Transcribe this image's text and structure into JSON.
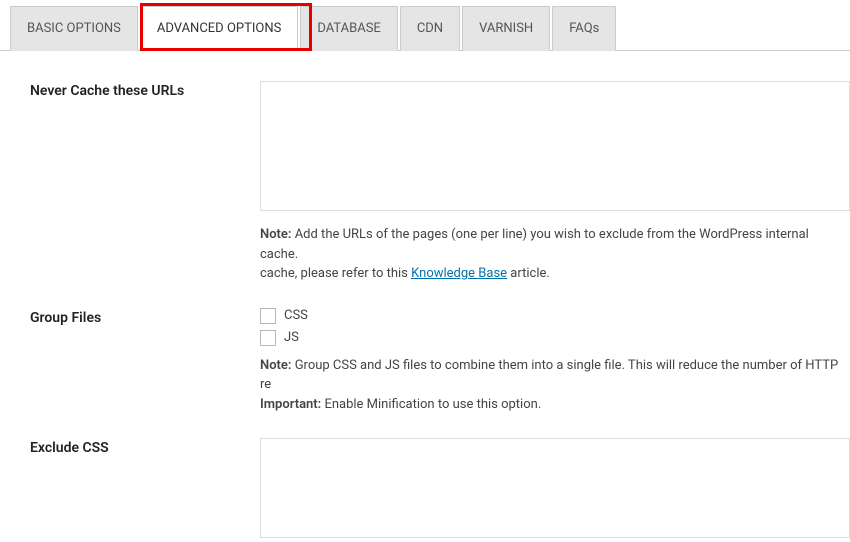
{
  "tabs": {
    "items": [
      {
        "label": "BASIC OPTIONS",
        "active": false
      },
      {
        "label": "ADVANCED OPTIONS",
        "active": true
      },
      {
        "label": "DATABASE",
        "active": false
      },
      {
        "label": "CDN",
        "active": false
      },
      {
        "label": "VARNISH",
        "active": false
      },
      {
        "label": "FAQs",
        "active": false
      }
    ]
  },
  "section_never_cache": {
    "label": "Never Cache these URLs",
    "value": "",
    "note_bold": "Note:",
    "note_text_1": " Add the URLs of the pages (one per line) you wish to exclude from the WordPress internal cache.",
    "note_text_2": " cache, please refer to this ",
    "note_link": "Knowledge Base",
    "note_text_3": " article."
  },
  "section_group_files": {
    "label": "Group Files",
    "checkbox_css": "CSS",
    "checkbox_js": "JS",
    "note_bold": "Note:",
    "note_text": " Group CSS and JS files to combine them into a single file. This will reduce the number of HTTP re",
    "important_bold": "Important:",
    "important_text": " Enable Minification to use this option."
  },
  "section_exclude_css": {
    "label": "Exclude CSS",
    "value": ""
  }
}
